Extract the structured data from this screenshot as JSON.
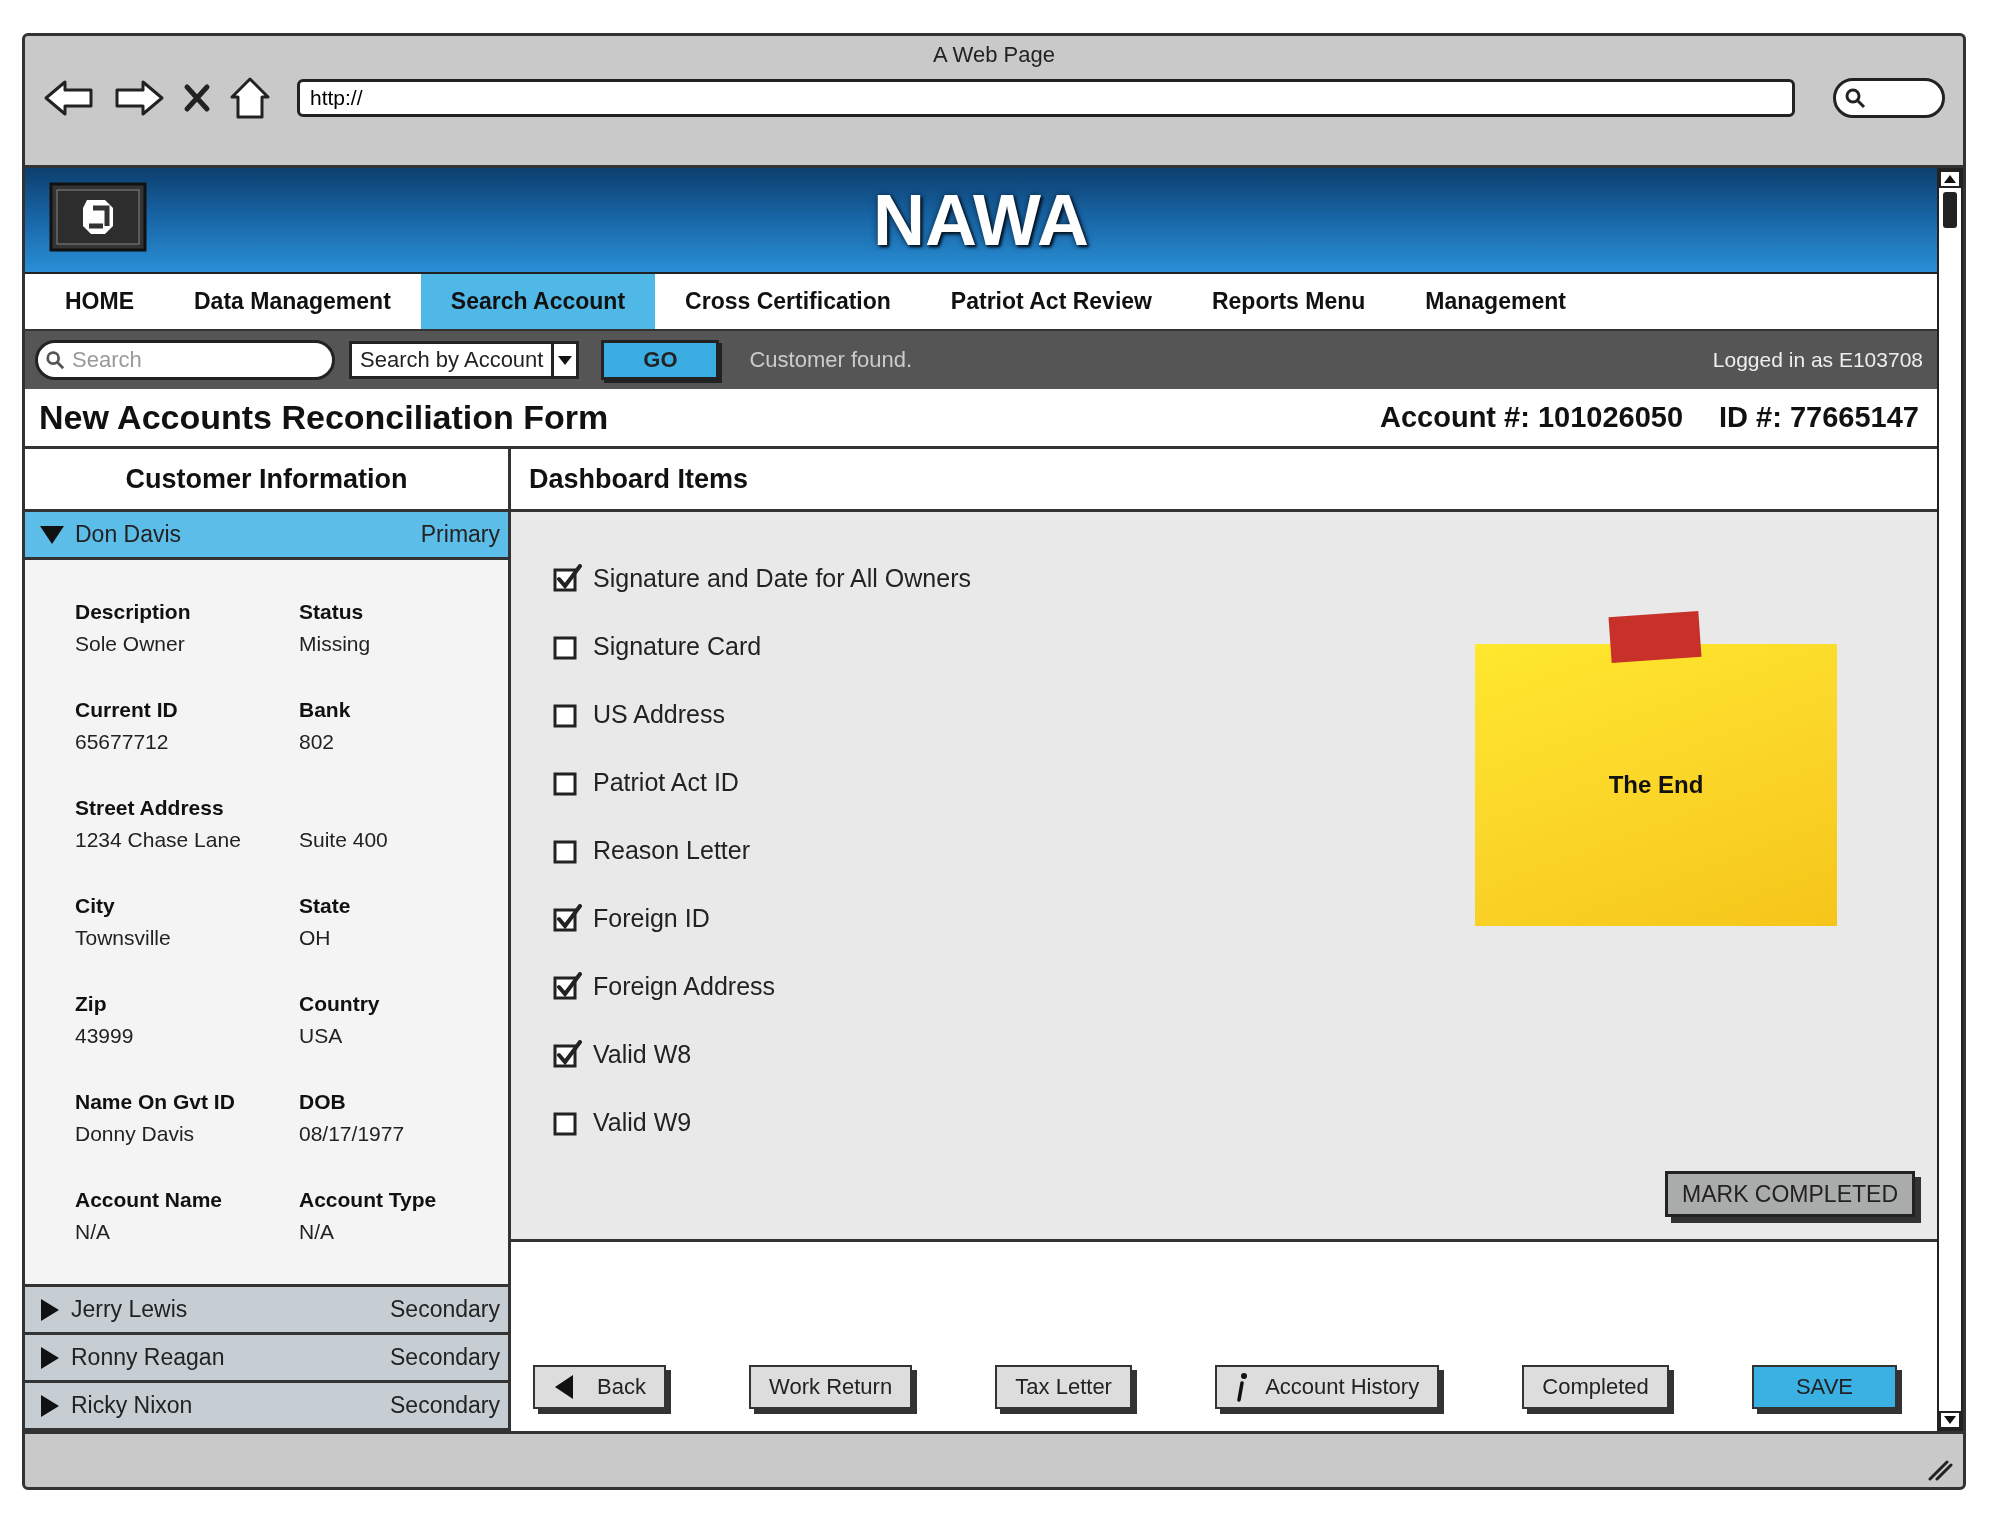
{
  "window": {
    "title": "A Web Page",
    "url": "http://"
  },
  "header": {
    "title": "NAWA"
  },
  "nav": {
    "items": [
      {
        "label": "HOME",
        "selected": false
      },
      {
        "label": "Data Management",
        "selected": false
      },
      {
        "label": "Search Account",
        "selected": true
      },
      {
        "label": "Cross Certification",
        "selected": false
      },
      {
        "label": "Patriot Act Review",
        "selected": false
      },
      {
        "label": "Reports Menu",
        "selected": false
      },
      {
        "label": "Management",
        "selected": false
      }
    ]
  },
  "toolbar": {
    "search": {
      "placeholder": "Search"
    },
    "search_mode": {
      "value": "Search by Account"
    },
    "go_button": "GO",
    "status_message": "Customer found.",
    "user": "Logged in as E103708"
  },
  "form": {
    "title": "New Accounts Reconciliation Form",
    "account": "Account #: 101026050",
    "id": "ID #: 77665147"
  },
  "customers": {
    "heading": "Customer Information",
    "items": [
      {
        "name": "Don Davis",
        "role": "Primary",
        "expanded": true,
        "fields": [
          {
            "label": "Description",
            "value": "Sole Owner"
          },
          {
            "label": "Status",
            "value": "Missing"
          },
          {
            "label": "Current ID",
            "value": "65677712"
          },
          {
            "label": "Bank",
            "value": "802"
          },
          {
            "label": "Street Address",
            "value": "1234 Chase Lane"
          },
          {
            "value": "Suite 400"
          },
          {
            "label": "City",
            "value": "Townsville"
          },
          {
            "label": "State",
            "value": "OH"
          },
          {
            "label": "Zip",
            "value": "43999"
          },
          {
            "label": "Country",
            "value": "USA"
          },
          {
            "label": "Name On Gvt ID",
            "value": "Donny Davis"
          },
          {
            "label": "DOB",
            "value": "08/17/1977"
          },
          {
            "label": "Account Name",
            "value": "N/A"
          },
          {
            "label": "Account Type",
            "value": "N/A"
          }
        ]
      },
      {
        "name": "Jerry Lewis",
        "role": "Secondary",
        "expanded": false
      },
      {
        "name": "Ronny Reagan",
        "role": "Secondary",
        "expanded": false
      },
      {
        "name": "Ricky Nixon",
        "role": "Secondary",
        "expanded": false
      }
    ]
  },
  "dashboard": {
    "heading": "Dashboard Items",
    "items": [
      {
        "label": "Signature and Date for All Owners",
        "checked": true
      },
      {
        "label": "Signature Card",
        "checked": false
      },
      {
        "label": "US Address",
        "checked": false
      },
      {
        "label": "Patriot Act ID",
        "checked": false
      },
      {
        "label": "Reason Letter",
        "checked": false
      },
      {
        "label": "Foreign ID",
        "checked": true
      },
      {
        "label": "Foreign Address",
        "checked": true
      },
      {
        "label": "Valid W8",
        "checked": true
      },
      {
        "label": "Valid W9",
        "checked": false
      }
    ],
    "note": {
      "text": "The End"
    },
    "mark_button": "MARK COMPLETED"
  },
  "buttons": [
    {
      "label": "Back",
      "kind": "back"
    },
    {
      "label": "Work Return",
      "kind": "plain"
    },
    {
      "label": "Tax Letter",
      "kind": "plain"
    },
    {
      "label": "Account History",
      "kind": "info"
    },
    {
      "label": "Completed",
      "kind": "plain"
    },
    {
      "label": "SAVE",
      "kind": "primary"
    }
  ]
}
